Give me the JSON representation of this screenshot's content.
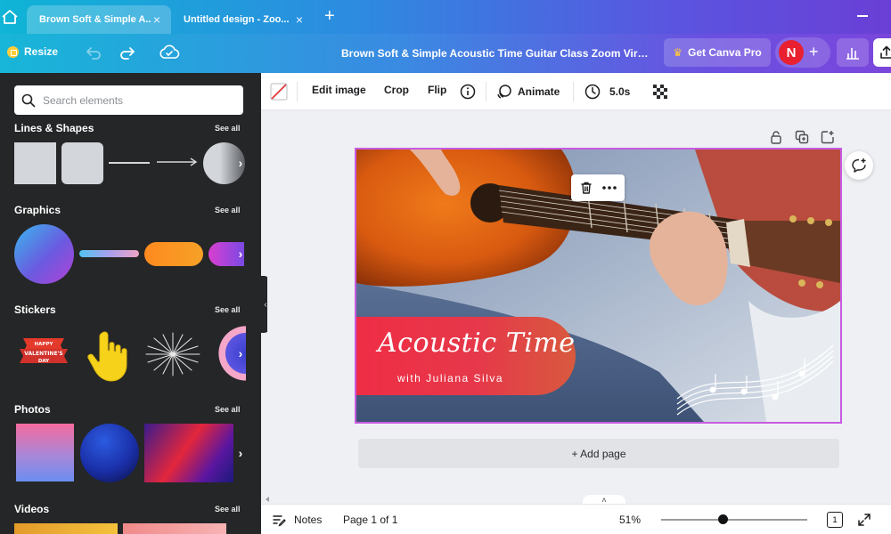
{
  "browser": {
    "tabs": [
      {
        "label": "Brown Soft & Simple A...",
        "active": true
      },
      {
        "label": "Untitled design - Zoo...",
        "active": false
      }
    ],
    "new_tab": "+"
  },
  "header": {
    "resize_label": "Resize",
    "doc_title": "Brown Soft & Simple Acoustic Time Guitar Class Zoom Virtu...",
    "get_pro_label": "Get Canva Pro",
    "avatar_initial": "N",
    "avatar_add": "+"
  },
  "panel": {
    "search_placeholder": "Search elements",
    "see_all": "See all",
    "sections": {
      "lines_shapes": "Lines & Shapes",
      "graphics": "Graphics",
      "stickers": "Stickers",
      "photos": "Photos",
      "videos": "Videos"
    },
    "sticker_text": "HAPPY VALENTINE'S DAY"
  },
  "toolbar": {
    "edit_image": "Edit image",
    "crop": "Crop",
    "flip": "Flip",
    "animate": "Animate",
    "duration": "5.0s"
  },
  "design": {
    "title": "Acoustic Time",
    "subtitle": "with Juliana Silva"
  },
  "canvas": {
    "add_page": "+ Add page"
  },
  "bottom": {
    "notes": "Notes",
    "page_indicator": "Page 1 of 1",
    "zoom": "51%",
    "page_count_badge": "1"
  },
  "colors": {
    "accent_purple": "#c85be0",
    "avatar_red": "#e8202f",
    "banner_red": "#ef2d45",
    "panel_bg": "#252627"
  }
}
